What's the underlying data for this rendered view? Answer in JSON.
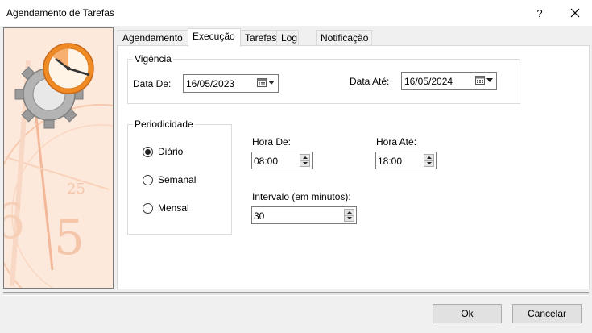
{
  "window": {
    "title": "Agendamento de Tarefas",
    "help_label": "?"
  },
  "tabs": [
    {
      "label": "Agendamento"
    },
    {
      "label": "Execução"
    },
    {
      "label": "Tarefas"
    },
    {
      "label": "Log"
    },
    {
      "label": "Notificação"
    }
  ],
  "active_tab": "Execução",
  "vigencia": {
    "legend": "Vigência",
    "data_de_label": "Data De:",
    "data_de_value": "16/05/2023",
    "data_ate_label": "Data Até:",
    "data_ate_value": "16/05/2024"
  },
  "periodicidade": {
    "legend": "Periodicidade",
    "options": [
      {
        "label": "Diário",
        "selected": true
      },
      {
        "label": "Semanal",
        "selected": false
      },
      {
        "label": "Mensal",
        "selected": false
      }
    ]
  },
  "schedule": {
    "hora_de_label": "Hora De:",
    "hora_de_value": "08:00",
    "hora_ate_label": "Hora Até:",
    "hora_ate_value": "18:00",
    "intervalo_label": "Intervalo (em minutos):",
    "intervalo_value": "30"
  },
  "buttons": {
    "ok": "Ok",
    "cancel": "Cancelar"
  },
  "colors": {
    "side_panel_bg": "#fde9dc",
    "clock_orange": "#f08a24",
    "gear_gray": "#9a9a9a"
  }
}
